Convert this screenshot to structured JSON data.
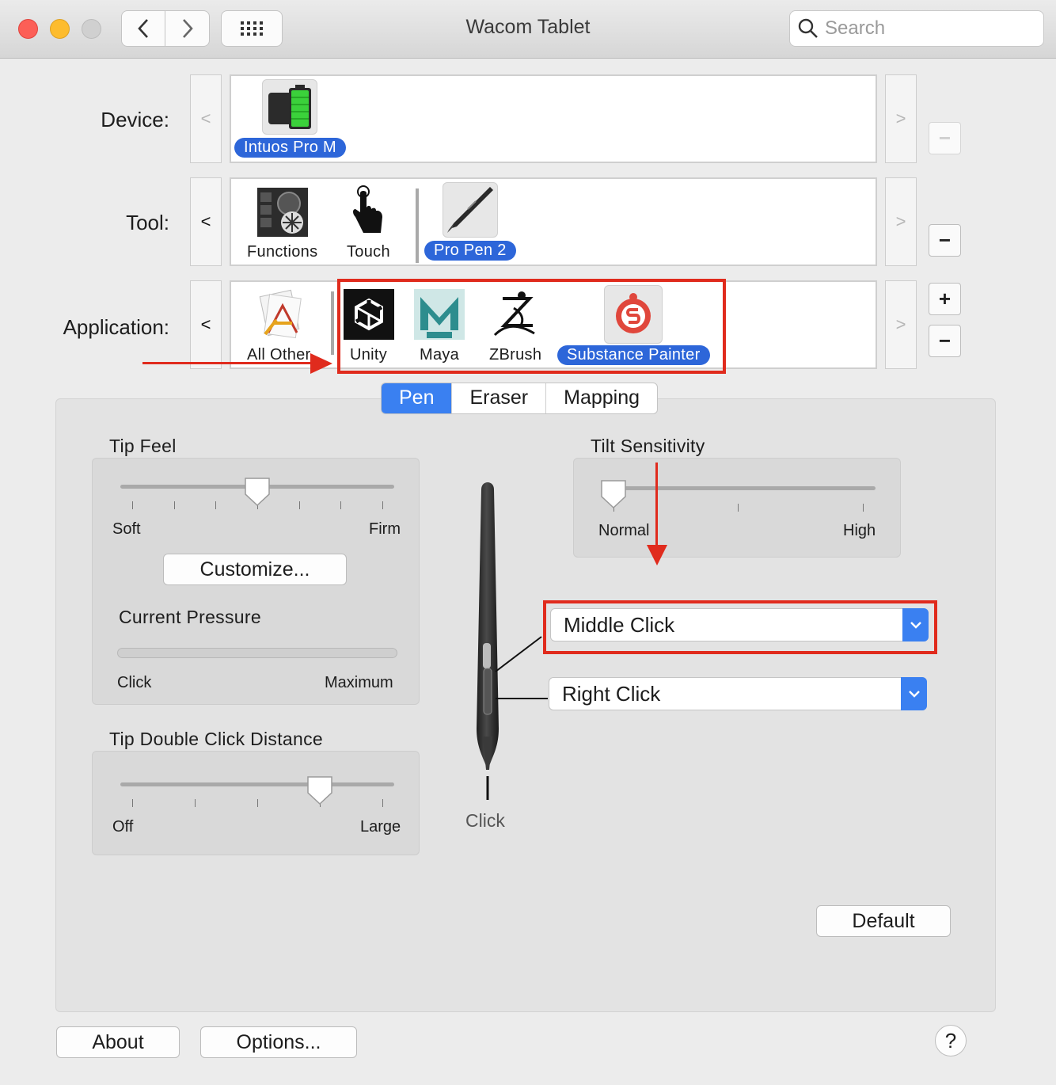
{
  "window": {
    "title": "Wacom Tablet"
  },
  "search": {
    "placeholder": "Search"
  },
  "rows": {
    "device_label": "Device:",
    "tool_label": "Tool:",
    "application_label": "Application:"
  },
  "device": {
    "items": [
      {
        "label": "Intuos Pro M",
        "selected": true
      }
    ]
  },
  "tools": {
    "items": [
      {
        "label": "Functions"
      },
      {
        "label": "Touch"
      },
      {
        "label": "Pro Pen 2",
        "selected": true
      }
    ]
  },
  "applications": {
    "items": [
      {
        "label": "All Other"
      },
      {
        "label": "Unity"
      },
      {
        "label": "Maya"
      },
      {
        "label": "ZBrush"
      },
      {
        "label": "Substance Painter",
        "selected": true
      }
    ]
  },
  "tabs": [
    {
      "label": "Pen",
      "active": true
    },
    {
      "label": "Eraser"
    },
    {
      "label": "Mapping"
    }
  ],
  "tip_feel": {
    "title": "Tip Feel",
    "min": "Soft",
    "max": "Firm",
    "value_step": 3,
    "steps": 7
  },
  "customize_label": "Customize...",
  "current_pressure": {
    "title": "Current Pressure",
    "min": "Click",
    "max": "Maximum"
  },
  "double_click": {
    "title": "Tip Double Click Distance",
    "min": "Off",
    "max": "Large",
    "value_step": 3,
    "steps": 5
  },
  "tilt": {
    "title": "Tilt Sensitivity",
    "min": "Normal",
    "max": "High",
    "value_step": 0
  },
  "pen_buttons": {
    "upper": "Middle Click",
    "lower": "Right Click",
    "tip": "Click"
  },
  "buttons": {
    "default": "Default",
    "about": "About",
    "options": "Options..."
  },
  "help_label": "?",
  "colors": {
    "accent": "#3a80f1",
    "selection": "#2d66d9",
    "annotation": "#e02b1d"
  }
}
